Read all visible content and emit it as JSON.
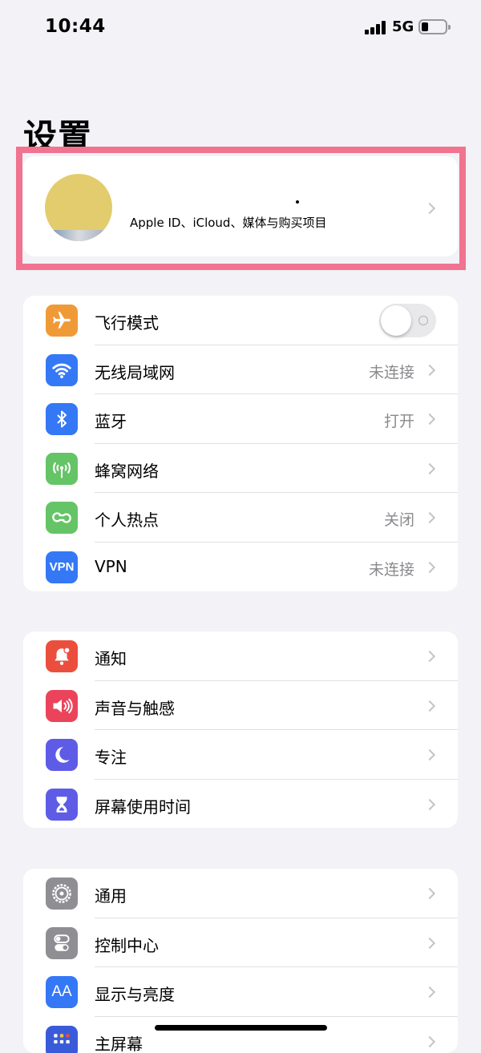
{
  "status_bar": {
    "time": "10:44",
    "network": "5G"
  },
  "page_title": "设置",
  "profile": {
    "subtitle": "Apple ID、iCloud、媒体与购买项目"
  },
  "group1": [
    {
      "label": "飞行模式",
      "value": "",
      "icon": "airplane-icon",
      "color": "#f09a37",
      "toggle": true
    },
    {
      "label": "无线局域网",
      "value": "未连接",
      "icon": "wifi-icon",
      "color": "#3478f6"
    },
    {
      "label": "蓝牙",
      "value": "打开",
      "icon": "bluetooth-icon",
      "color": "#3478f6"
    },
    {
      "label": "蜂窝网络",
      "value": "",
      "icon": "cellular-icon",
      "color": "#65c466"
    },
    {
      "label": "个人热点",
      "value": "关闭",
      "icon": "hotspot-icon",
      "color": "#65c466"
    },
    {
      "label": "VPN",
      "value": "未连接",
      "icon": "vpn-icon",
      "color": "#3478f6",
      "icon_text": "VPN"
    }
  ],
  "group2": [
    {
      "label": "通知",
      "value": "",
      "icon": "notifications-icon",
      "color": "#eb4e3d"
    },
    {
      "label": "声音与触感",
      "value": "",
      "icon": "sound-icon",
      "color": "#eb445a"
    },
    {
      "label": "专注",
      "value": "",
      "icon": "moon-icon",
      "color": "#5e5ce6"
    },
    {
      "label": "屏幕使用时间",
      "value": "",
      "icon": "hourglass-icon",
      "color": "#5e5ce6"
    }
  ],
  "group3": [
    {
      "label": "通用",
      "value": "",
      "icon": "gear-icon",
      "color": "#8e8e93"
    },
    {
      "label": "控制中心",
      "value": "",
      "icon": "control-center-icon",
      "color": "#8e8e93"
    },
    {
      "label": "显示与亮度",
      "value": "",
      "icon": "display-icon",
      "color": "#3478f6",
      "icon_text": "AA"
    },
    {
      "label": "主屏幕",
      "value": "",
      "icon": "home-screen-icon",
      "color": "#3a5bd9"
    }
  ]
}
